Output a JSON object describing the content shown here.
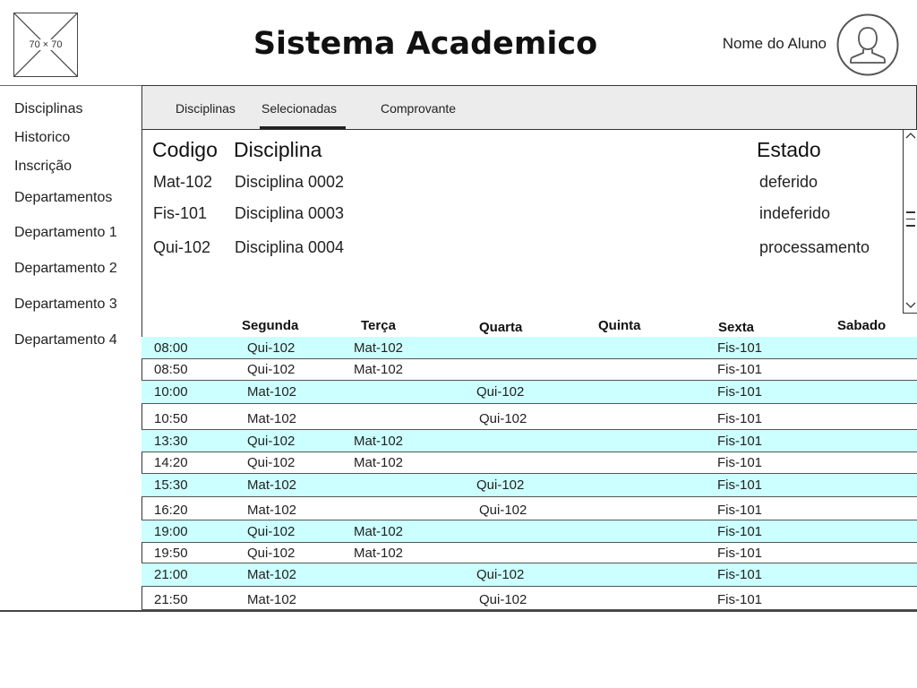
{
  "header": {
    "logo_placeholder": "70 × 70",
    "title": "Sistema Academico",
    "user_name": "Nome do Aluno"
  },
  "sidebar": {
    "items": [
      {
        "label": "Disciplinas"
      },
      {
        "label": "Historico"
      },
      {
        "label": "Inscrição"
      },
      {
        "label": "Departamentos"
      },
      {
        "label": "Departamento 1"
      },
      {
        "label": "Departamento 2"
      },
      {
        "label": "Departamento 3"
      },
      {
        "label": "Departamento 4"
      }
    ]
  },
  "tabs": [
    {
      "label": "Disciplinas"
    },
    {
      "label": "Selecionadas",
      "active": true
    },
    {
      "label": "Comprovante"
    }
  ],
  "disciplines": {
    "headers": {
      "code": "Codigo",
      "name": "Disciplina",
      "status": "Estado"
    },
    "rows": [
      {
        "code": "Mat-102",
        "name": "Disciplina 0002",
        "status": "deferido"
      },
      {
        "code": "Fis-101",
        "name": "Disciplina 0003",
        "status": "indeferido"
      },
      {
        "code": "Qui-102",
        "name": "Disciplina 0004",
        "status": "processamento"
      }
    ]
  },
  "schedule": {
    "days": [
      "Segunda",
      "Terça",
      "Quarta",
      "Quinta",
      "Sexta",
      "Sabado"
    ],
    "rows": [
      {
        "time": "08:00",
        "segunda": "Qui-102",
        "terca": "Mat-102",
        "quarta": "",
        "sexta": "Fis-101"
      },
      {
        "time": "08:50",
        "segunda": "Qui-102",
        "terca": "Mat-102",
        "quarta": "",
        "sexta": "Fis-101"
      },
      {
        "time": "10:00",
        "segunda": "Mat-102",
        "terca": "",
        "quarta": "Qui-102",
        "sexta": "Fis-101"
      },
      {
        "time": "10:50",
        "segunda": "Mat-102",
        "terca": "",
        "quarta": "Qui-102",
        "sexta": "Fis-101"
      },
      {
        "time": "13:30",
        "segunda": "Qui-102",
        "terca": "Mat-102",
        "quarta": "",
        "sexta": "Fis-101"
      },
      {
        "time": "14:20",
        "segunda": "Qui-102",
        "terca": "Mat-102",
        "quarta": "",
        "sexta": "Fis-101"
      },
      {
        "time": "15:30",
        "segunda": "Mat-102",
        "terca": "",
        "quarta": "Qui-102",
        "sexta": "Fis-101"
      },
      {
        "time": "16:20",
        "segunda": "Mat-102",
        "terca": "",
        "quarta": "Qui-102",
        "sexta": "Fis-101"
      },
      {
        "time": "19:00",
        "segunda": "Qui-102",
        "terca": "Mat-102",
        "quarta": "",
        "sexta": "Fis-101"
      },
      {
        "time": "19:50",
        "segunda": "Qui-102",
        "terca": "Mat-102",
        "quarta": "",
        "sexta": "Fis-101"
      },
      {
        "time": "21:00",
        "segunda": "Mat-102",
        "terca": "",
        "quarta": "Qui-102",
        "sexta": "Fis-101"
      },
      {
        "time": "21:50",
        "segunda": "Mat-102",
        "terca": "",
        "quarta": "Qui-102",
        "sexta": "Fis-101"
      }
    ]
  },
  "colors": {
    "row_highlight": "#ccffff",
    "tabbar_bg": "#ececec"
  }
}
